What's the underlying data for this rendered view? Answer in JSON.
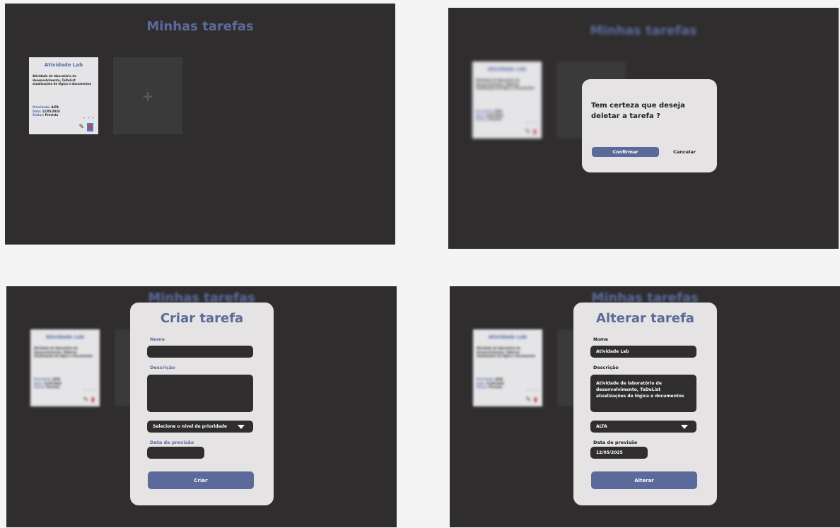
{
  "page_title": "Minhas tarefas",
  "card": {
    "title": "Atividade Lab",
    "description": "Atividade de laboratório de desenvolvimento, ToDoList atualizações de lógica e documentos",
    "priority_label": "Prioridade:",
    "priority_value": "ALTA",
    "date_label": "Data:",
    "date_value": "12/05/2024",
    "status_label": "Status:",
    "status_value": "Prevista",
    "more": "• • •",
    "add": "+"
  },
  "confirm_dialog": {
    "question": "Tem certeza que deseja deletar a tarefa ?",
    "confirm_label": "Confirmar",
    "cancel_label": "Cancelar"
  },
  "create_form": {
    "title": "Criar tarefa",
    "name_label": "Nome",
    "desc_label": "Descrição",
    "priority_placeholder": "Selecione o nível de prioridade",
    "date_label": "Data de previsão",
    "submit_label": "Criar"
  },
  "edit_form": {
    "title": "Alterar tarefa",
    "name_label": "Nome",
    "name_value": "Atividade Lab",
    "desc_label": "Descrição",
    "desc_value": "Atividade de laboratório de desenvolvimento, ToDoList atualizações de lógica e documentos",
    "priority_value": "ALTA",
    "date_label": "Data de previsão",
    "date_value": "12/05/2025",
    "submit_label": "Alterar"
  },
  "colors": {
    "panel_bg": "#2f2d2e",
    "accent": "#5b6a9a",
    "card_bg": "#e5e4e6",
    "delete_red": "#d43b3b"
  }
}
